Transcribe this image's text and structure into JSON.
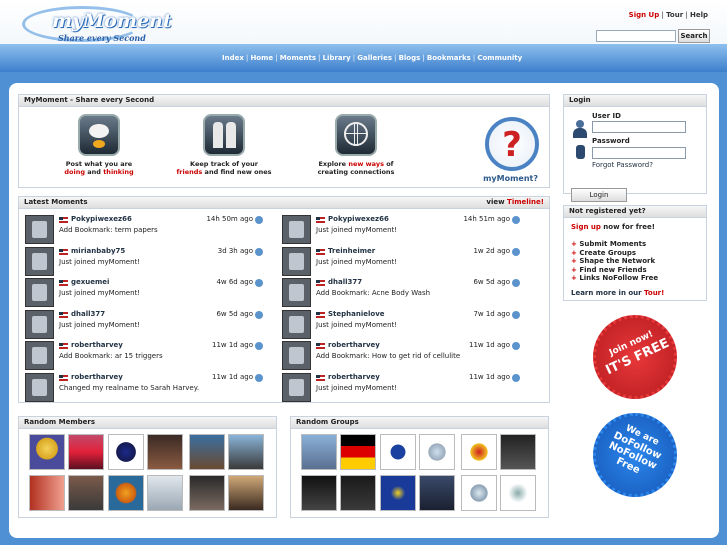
{
  "header": {
    "logo_name": "myMoment",
    "logo_tagline": "Share every Second",
    "links": [
      "Sign Up",
      "Tour",
      "Help"
    ],
    "search_button": "Search",
    "nav": [
      "Index",
      "Home",
      "Moments",
      "Library",
      "Galleries",
      "Blogs",
      "Bookmarks",
      "Community"
    ]
  },
  "intro": {
    "title": "MyMoment - Share every Second",
    "features": [
      {
        "l1": "Post what you are",
        "l2a": "doing",
        "l2b": " and ",
        "l2c": "thinking"
      },
      {
        "l1": "Keep track of your",
        "l2a": "friends",
        "l2b": " and find new ones"
      },
      {
        "l1a": "Explore ",
        "l1b": "new ways",
        "l1c": " of",
        "l2": "creating connections"
      }
    ],
    "brand": "myMoment?"
  },
  "latest": {
    "title": "Latest Moments",
    "view": "view ",
    "timeline": "Timeline!",
    "left": [
      {
        "user": "Pokypiwexez66",
        "time": "14h 50m ago",
        "action": "Add Bookmark: term papers"
      },
      {
        "user": "mirianbaby75",
        "time": "3d 3h ago",
        "action": "Just joined myMoment!"
      },
      {
        "user": "gexuemei",
        "time": "4w 6d ago",
        "action": "Just joined myMoment!"
      },
      {
        "user": "dhall377",
        "time": "6w 5d ago",
        "action": "Just joined myMoment!"
      },
      {
        "user": "robertharvey",
        "time": "11w 1d ago",
        "action": "Add Bookmark: ar 15 triggers"
      },
      {
        "user": "robertharvey",
        "time": "11w 1d ago",
        "action": "Changed my realname to Sarah Harvey."
      }
    ],
    "right": [
      {
        "user": "Pokypiwexez66",
        "time": "14h 51m ago",
        "action": "Just joined myMoment!"
      },
      {
        "user": "Treinheimer",
        "time": "1w 2d ago",
        "action": "Just joined myMoment!"
      },
      {
        "user": "dhall377",
        "time": "6w 5d ago",
        "action": "Add Bookmark: Acne Body Wash"
      },
      {
        "user": "Stephanielove",
        "time": "7w 1d ago",
        "action": "Just joined myMoment!"
      },
      {
        "user": "robertharvey",
        "time": "11w 1d ago",
        "action": "Add Bookmark: How to get rid of cellulite"
      },
      {
        "user": "robertharvey",
        "time": "11w 1d ago",
        "action": "Just joined myMoment!"
      }
    ]
  },
  "members": {
    "title": "Random Members"
  },
  "groups": {
    "title": "Random Groups"
  },
  "login": {
    "title": "Login",
    "user_label": "User ID",
    "pass_label": "Password",
    "forgot": "Forgot Password?",
    "button": "Login"
  },
  "notreg": {
    "title": "Not registered yet?",
    "signup": "Sign up",
    "signup_rest": " now for free!",
    "items": [
      "Submit Moments",
      "Create Groups",
      "Shape the Network",
      "Find new Friends",
      "Links NoFollow Free"
    ],
    "learn": "Learn more in our ",
    "tour": "Tour!"
  },
  "badges": {
    "b1_l1": "Join now!",
    "b1_l2": "IT'S FREE",
    "b2_l1": "We are",
    "b2_l2": "DoFollow",
    "b2_l3": "NoFollow",
    "b2_l4": "Free"
  },
  "colors": {
    "accent_red": "#cc0000",
    "brand_blue": "#4f8fd3",
    "badge_red": "#d8262a",
    "badge_blue": "#1e6fd6"
  }
}
